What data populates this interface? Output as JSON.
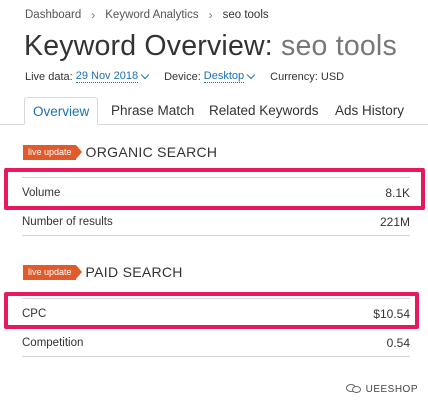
{
  "breadcrumb": {
    "items": [
      "Dashboard",
      "Keyword Analytics",
      "seo tools"
    ],
    "separator": "›"
  },
  "title": {
    "main": "Keyword Overview:",
    "keyword": "seo tools"
  },
  "meta": {
    "live_label": "Live data:",
    "live_value": "29 Nov 2018",
    "device_label": "Device:",
    "device_value": "Desktop",
    "currency": "Currency: USD"
  },
  "tabs": [
    "Overview",
    "Phrase Match",
    "Related Keywords",
    "Ads History"
  ],
  "organic": {
    "badge": "live update",
    "title": "ORGANIC SEARCH",
    "rows": [
      {
        "label": "Volume",
        "value": "8.1K"
      },
      {
        "label": "Number of results",
        "value": "221M"
      }
    ]
  },
  "paid": {
    "badge": "live update",
    "title": "PAID SEARCH",
    "rows": [
      {
        "label": "CPC",
        "value": "$10.54"
      },
      {
        "label": "Competition",
        "value": "0.54"
      }
    ]
  },
  "watermark": "UEESHOP",
  "colors": {
    "accent_link": "#1d6fb8",
    "badge": "#e05a2a",
    "highlight": "#e8185c"
  }
}
